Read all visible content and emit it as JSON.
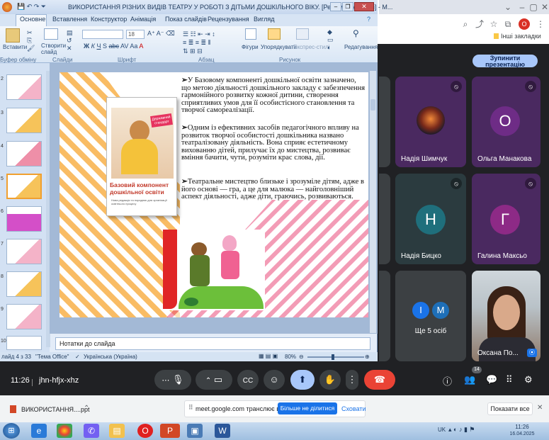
{
  "ppt": {
    "title": "ВИКОРИСТАННЯ РІЗНИХ ВИДІВ ТЕАТРУ У РОБОТІ З ДІТЬМИ ДОШКІЛЬНОГО ВІКУ. [Режим сумісності] - M...",
    "tabs": [
      "Основне",
      "Вставлення",
      "Конструктор",
      "Анімація",
      "Показ слайдів",
      "Рецензування",
      "Вигляд"
    ],
    "ribbon": {
      "paste": "Вставити",
      "new_slide": "Створити слайд",
      "figures": "Фігури",
      "arrange": "Упорядкувати",
      "express": "Експрес-стилі",
      "editing": "Редагування",
      "font_size": "18",
      "group_clipboard": "Буфер обміну",
      "group_slides": "Слайди",
      "group_font": "Шрифт",
      "group_paragraph": "Абзац",
      "group_drawing": "Рисунок"
    },
    "thumb_numbers": [
      "2",
      "3",
      "4",
      "5",
      "6",
      "7",
      "8",
      "9",
      "10"
    ],
    "slide": {
      "book_title": "Базовий компонент дошкільної освіти",
      "book_sub": "Нова редакція та порадник для організації освітнього процесу",
      "book_stamp": "Державний стандарт",
      "bullet1": "У Базовому компоненті дошкільної освіти зазначено, що метою діяльності дошкільного закладу є забезпечення гармонійного розвитку кожної дитини, створення сприятливих умов для її особистісного становлення та творчої самореалізації.",
      "bullet2": "Одним із ефективних засобів педагогічного впливу на розвиток творчої особистості дошкільника названо театралізовану діяльність. Вона сприяє естетичному вихованню дітей, прилучає їх до мистецтва, розвиває вміння бачити, чути, розуміти крас слова, дії.",
      "bullet3": "Театральне мистецтво близьке і зрозуміле дітям, адже в його основі — гра, а це для малюка — найголовніший аспект діяльності, адже діти, граючись, розвиваються."
    },
    "notes_placeholder": "Нотатки до слайда",
    "status": {
      "slide_info": "лайд 4 з 33",
      "theme": "\"Тема Office\"",
      "language": "Українська (Україна)",
      "zoom": "80%"
    }
  },
  "chrome": {
    "bookmarks_label": "Інші закладки",
    "profile_initial": "О"
  },
  "meet": {
    "stop_presenting": "Зупинити презентацію",
    "participants": [
      {
        "name": "Надія Шимчук",
        "initial": ""
      },
      {
        "name": "Ольга Манакова",
        "initial": "О"
      },
      {
        "name": "Надія Бицко",
        "initial": "Н"
      },
      {
        "name": "Галина Максьо",
        "initial": "Г"
      },
      {
        "name": "Ще 5 осіб",
        "initial": "І"
      },
      {
        "name": "Оксана По...",
        "initial": ""
      }
    ],
    "more_initials": [
      "І",
      "М"
    ],
    "time": "11:26",
    "meeting_code": "jhn-hfjx-xhz",
    "participant_count": "14"
  },
  "share_bar": {
    "file_label": "ВИКОРИСТАННЯ....ppt",
    "notice_text": "meet.google.com транслює вікно.",
    "stop_sharing": "Більше не ділитися",
    "hide": "Сховати",
    "show_all": "Показати все"
  },
  "taskbar": {
    "lang": "UK",
    "time": "11:26",
    "date": "16.04.2025"
  }
}
